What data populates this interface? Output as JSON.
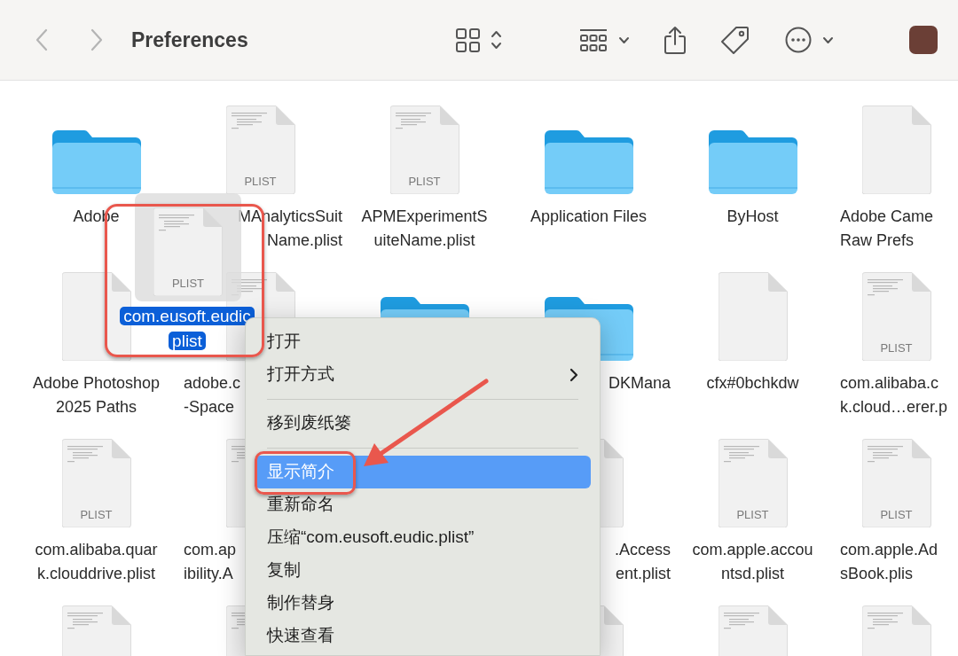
{
  "toolbar": {
    "title": "Preferences"
  },
  "rows": [
    [
      {
        "kind": "folder",
        "name_lines": [
          "Adobe"
        ]
      },
      {
        "kind": "document",
        "preview": true,
        "badge": "PLIST",
        "name_lines": [
          "MAnalyticsSuit",
          "Name.plist"
        ]
      },
      {
        "kind": "document",
        "preview": true,
        "badge": "PLIST",
        "name_lines": [
          "APMExperimentS",
          "uiteName.plist"
        ]
      },
      {
        "kind": "folder",
        "name_lines": [
          "Application Files"
        ]
      },
      {
        "kind": "folder",
        "name_lines": [
          "ByHost"
        ]
      },
      {
        "kind": "document",
        "preview": false,
        "name_lines": [
          "Adobe Came",
          "Raw Prefs"
        ]
      }
    ],
    [
      {
        "kind": "document",
        "preview": false,
        "name_lines": [
          "Adobe Photoshop",
          "2025 Paths"
        ]
      },
      {
        "kind": "document",
        "preview": true,
        "name_lines": [
          "adobe.c",
          "-Space"
        ]
      },
      {
        "kind": "folder"
      },
      {
        "kind": "folder",
        "name_lines": [
          "DKMana"
        ]
      },
      {
        "kind": "document",
        "preview": false,
        "name_lines": [
          "cfx#0bchkdw"
        ]
      },
      {
        "kind": "document",
        "preview": true,
        "badge": "PLIST",
        "name_lines": [
          "com.alibaba.c",
          "k.cloud…erer.p"
        ]
      }
    ],
    [
      {
        "kind": "document",
        "preview": true,
        "badge": "PLIST",
        "name_lines": [
          "com.alibaba.quar",
          "k.clouddrive.plist"
        ]
      },
      {
        "kind": "document",
        "preview": true,
        "name_lines": [
          "com.ap",
          "ibility.A"
        ]
      },
      null,
      {
        "kind": "document",
        "name_lines": [
          ".Access",
          "ent.plist"
        ]
      },
      {
        "kind": "document",
        "preview": true,
        "badge": "PLIST",
        "name_lines": [
          "com.apple.accou",
          "ntsd.plist"
        ]
      },
      {
        "kind": "document",
        "preview": true,
        "badge": "PLIST",
        "name_lines": [
          "com.apple.Ad",
          "sBook.plis"
        ]
      }
    ],
    [
      {
        "kind": "document",
        "preview": true
      },
      {
        "kind": "document",
        "preview": true
      },
      null,
      {
        "kind": "document"
      },
      {
        "kind": "document",
        "preview": true
      },
      {
        "kind": "document",
        "preview": true
      }
    ]
  ],
  "dragged_file": {
    "badge": "PLIST",
    "name_lines": [
      "com.eusoft.eudic",
      "plist"
    ],
    "selected": true
  },
  "context_menu": {
    "items": [
      {
        "kind": "item",
        "label": "打开",
        "selected": false,
        "submenu": false
      },
      {
        "kind": "item",
        "label": "打开方式",
        "selected": false,
        "submenu": true
      },
      {
        "kind": "separator"
      },
      {
        "kind": "item",
        "label": "移到废纸篓",
        "selected": false,
        "submenu": false
      },
      {
        "kind": "separator"
      },
      {
        "kind": "item",
        "label": "显示简介",
        "selected": true,
        "submenu": false
      },
      {
        "kind": "item",
        "label": "重新命名",
        "selected": false,
        "submenu": false
      },
      {
        "kind": "item",
        "label": "压缩“com.eusoft.eudic.plist”",
        "selected": false,
        "submenu": false
      },
      {
        "kind": "item",
        "label": "复制",
        "selected": false,
        "submenu": false
      },
      {
        "kind": "item",
        "label": "制作替身",
        "selected": false,
        "submenu": false
      },
      {
        "kind": "item",
        "label": "快速查看",
        "selected": false,
        "submenu": false
      }
    ]
  },
  "annotations": [
    {
      "kind": "file-box"
    },
    {
      "kind": "item-box"
    },
    {
      "kind": "arrow"
    }
  ]
}
